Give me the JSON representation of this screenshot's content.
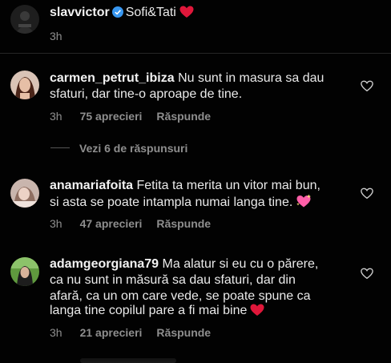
{
  "caption": {
    "username": "slavvictor",
    "text": "Sofi&Tati",
    "time": "3h",
    "emoji": "red-heart"
  },
  "comments": [
    {
      "username": "carmen_petrut_ibiza",
      "lines": [
        "Nu sunt in masura sa dau",
        "sfaturi, dar tine-o aproape de tine."
      ],
      "time": "3h",
      "likes": "75 aprecieri",
      "reply": "Răspunde",
      "avatar_color": "#7a4b3a"
    },
    {
      "username": "anamariafoita",
      "lines": [
        "Fetita ta merita un vitor mai bun,",
        "si asta se poate intampla numai langa tine."
      ],
      "time": "3h",
      "likes": "47 aprecieri",
      "reply": "Răspunde",
      "emoji": "sparkling-heart",
      "avatar_color": "#b89a93"
    },
    {
      "username": "adamgeorgiana79",
      "lines": [
        "Ma alatur si eu cu o părere,",
        "ca nu sunt in măsură sa dau sfaturi, dar din",
        "afară, ca un om care vede, se poate spune ca",
        "langa tine copilul pare a fi mai bine"
      ],
      "time": "3h",
      "likes": "21 aprecieri",
      "reply": "Răspunde",
      "emoji": "red-heart",
      "avatar_color": "#3e7a2c"
    }
  ],
  "view_replies": "Vezi 6 de răspunsuri",
  "colors": {
    "background": "#020202",
    "text": "#eaeaea",
    "muted": "#8e8e8e",
    "verified": "#3897f0",
    "heart_red": "#e0173a",
    "sparkle_pink": "#ff5fa8"
  }
}
